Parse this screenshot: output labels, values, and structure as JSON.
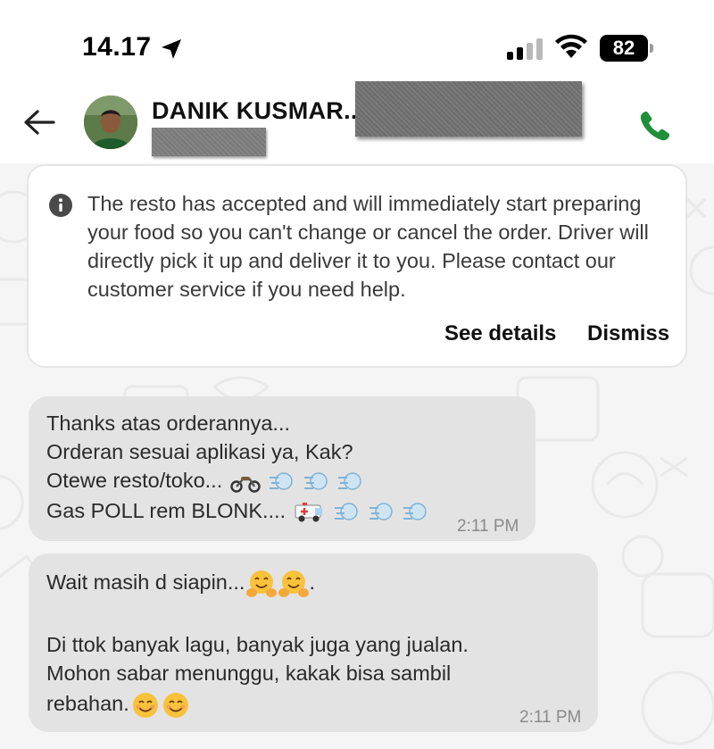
{
  "status_bar": {
    "time": "14.17",
    "battery": "82",
    "icons": [
      "location-arrow-icon",
      "signal-icon",
      "wifi-icon",
      "battery-icon"
    ]
  },
  "header": {
    "contact_name": "DANIK KUSMAR..",
    "icons": [
      "back-arrow-icon",
      "phone-icon"
    ],
    "accent_color": "#1f8f3a"
  },
  "notice": {
    "text": "The resto has accepted and will immediately start preparing your food so you can't change or cancel the order. Driver will directly pick it up and deliver it to you. Please contact our customer service if you need help.",
    "lines": [
      "The resto has accepted and will immediately start preparing",
      "your food so you can't change or cancel the order. Driver will",
      "directly pick it up and deliver it to you. Please contact our",
      "customer service if you need help."
    ],
    "see_details": "See details",
    "dismiss": "Dismiss"
  },
  "messages": [
    {
      "lines": [
        "Thanks atas orderannya...",
        "Orderan sesuai aplikasi ya, Kak?",
        "Otewe resto/toko...",
        "Gas POLL rem BLONK...."
      ],
      "emoji_icons": [
        "motorcycle-icon",
        "dash-icon",
        "ambulance-icon"
      ],
      "time": "2:11 PM"
    },
    {
      "lines": [
        "Wait masih d siapin...",
        ".",
        "Di ttok banyak lagu, banyak juga yang jualan.",
        "Mohon sabar menunggu, kakak bisa sambil",
        "rebahan."
      ],
      "emoji_icons": [
        "hugging-face-icon",
        "smiling-face-icon"
      ],
      "time": "2:11 PM"
    }
  ]
}
